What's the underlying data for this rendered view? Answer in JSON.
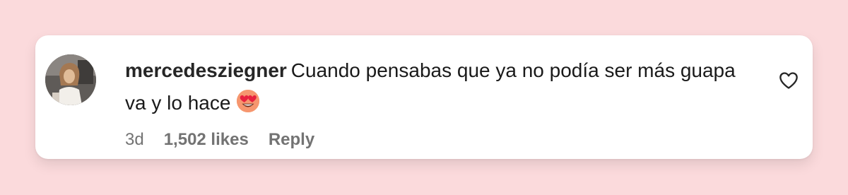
{
  "comment": {
    "username": "mercedesziegner",
    "text": "Cuando pensabas que ya no podía ser más guapa va y lo hace",
    "emoji": "heart-eyes-emoji",
    "timestamp": "3d",
    "likes": "1,502 likes",
    "reply_label": "Reply",
    "like_icon": "heart-outline-icon"
  },
  "colors": {
    "background": "#fbdadc",
    "card": "#ffffff",
    "username": "#262626",
    "text": "#1a1a1a",
    "meta": "#737373"
  }
}
